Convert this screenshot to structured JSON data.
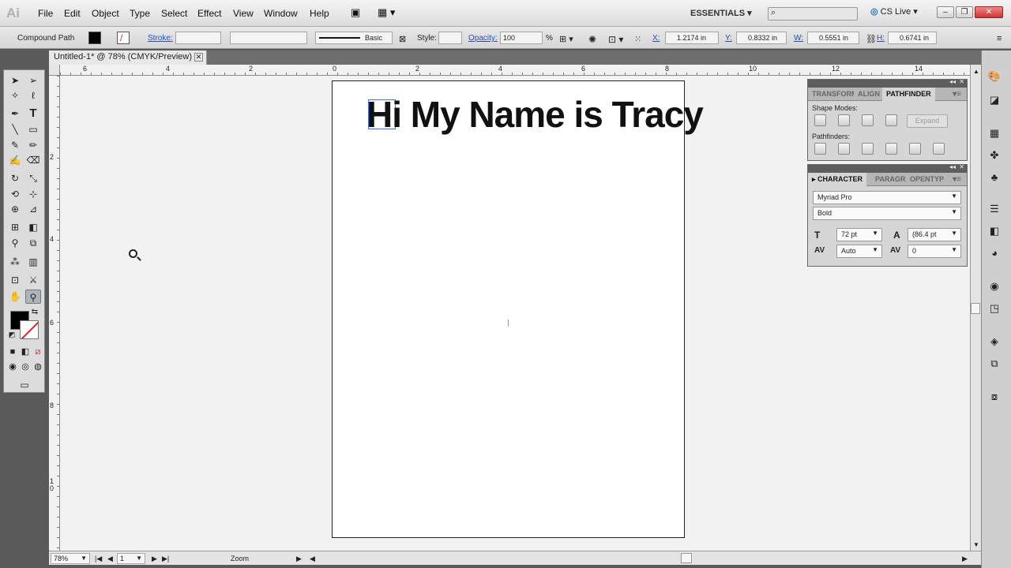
{
  "app": {
    "logo": "Ai",
    "workspace": "ESSENTIALS",
    "cs_live": "CS Live"
  },
  "menu": [
    "File",
    "Edit",
    "Object",
    "Type",
    "Select",
    "Effect",
    "View",
    "Window",
    "Help"
  ],
  "control": {
    "selection_type": "Compound Path",
    "stroke_label": "Stroke:",
    "brush_label": "Basic",
    "style_label": "Style:",
    "opacity_label": "Opacity:",
    "opacity_value": "100",
    "opacity_unit": "%",
    "x_label": "X:",
    "x_value": "1.2174 in",
    "y_label": "Y:",
    "y_value": "0.8332 in",
    "w_label": "W:",
    "w_value": "0.5551 in",
    "h_label": "H:",
    "h_value": "0.6741 in"
  },
  "document": {
    "tab_title": "Untitled-1* @ 78% (CMYK/Preview)",
    "headline": "Hi My Name is Tracy",
    "ruler_h": [
      "6",
      "4",
      "2",
      "0",
      "2",
      "4",
      "6",
      "8",
      "10",
      "12",
      "14"
    ],
    "ruler_v": [
      "2",
      "4",
      "6",
      "8",
      "1\n0"
    ]
  },
  "status": {
    "zoom": "78%",
    "page": "1",
    "tool": "Zoom"
  },
  "pathfinder_panel": {
    "tabs": [
      "TRANSFORM",
      "ALIGN",
      "PATHFINDER"
    ],
    "active_tab": "PATHFINDER",
    "shape_modes_label": "Shape Modes:",
    "pathfinders_label": "Pathfinders:",
    "expand_label": "Expand"
  },
  "character_panel": {
    "tabs": [
      "CHARACTER",
      "PARAGRAPH",
      "OPENTYPE"
    ],
    "active_tab": "CHARACTER",
    "font_family": "Myriad Pro",
    "font_style": "Bold",
    "font_size": "72 pt",
    "leading": "(86.4 pt",
    "kerning": "Auto",
    "tracking": "0"
  }
}
